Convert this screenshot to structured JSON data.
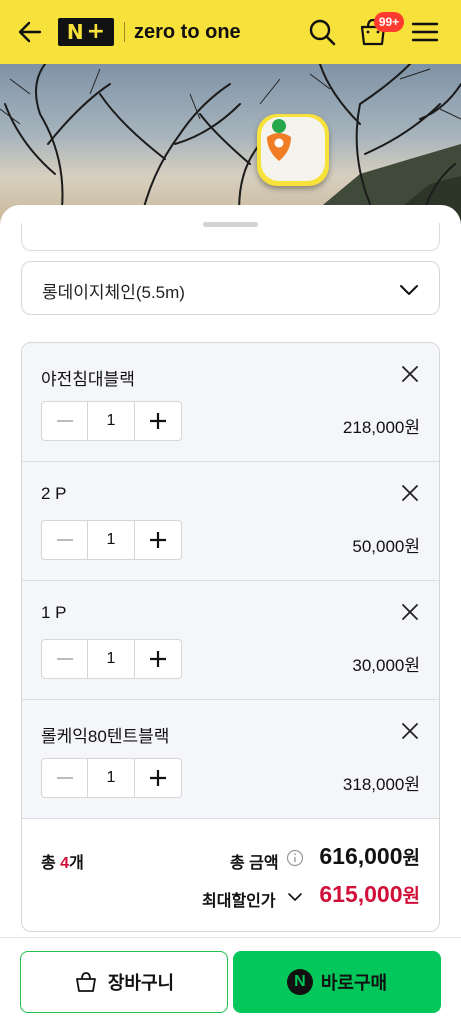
{
  "header": {
    "logo_n": "N",
    "logo_plus": "+",
    "store_name": "zero to one",
    "cart_badge": "99+",
    "colors": {
      "bar": "#f7e13b",
      "badge": "#ff3b30"
    }
  },
  "hero": {
    "badge_icon": "carrot-icon"
  },
  "options": {
    "selected_option": "롱데이지체인(5.5m)"
  },
  "items": [
    {
      "name": "야전침대블랙",
      "qty": "1",
      "price": "218,000원"
    },
    {
      "name": "2 P",
      "qty": "1",
      "price": "50,000원"
    },
    {
      "name": "1 P",
      "qty": "1",
      "price": "30,000원"
    },
    {
      "name": "롤케익80텐트블랙",
      "qty": "1",
      "price": "318,000원"
    }
  ],
  "summary": {
    "count_prefix": "총 ",
    "count": "4",
    "count_suffix": "개",
    "total_label": "총 금액",
    "total_value": "616,000",
    "total_won": "원",
    "discount_label": "최대할인가",
    "discount_value": "615,000",
    "discount_won": "원",
    "discount_color": "#d1103a"
  },
  "bottom": {
    "cart_label": "장바구니",
    "buy_label": "바로구매",
    "npay_letter": "N",
    "buy_color": "#03c75a"
  }
}
